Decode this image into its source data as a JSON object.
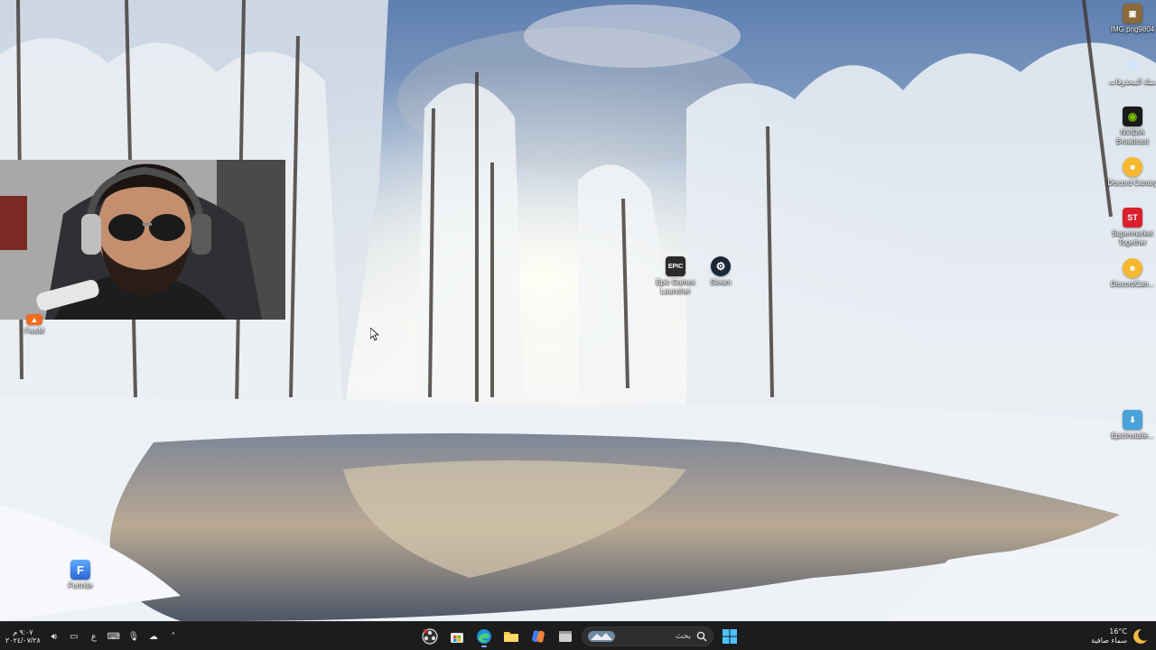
{
  "desktop": {
    "icons_right": [
      {
        "label": "IMG.png9804",
        "icon": "image-file-icon",
        "color": "#8a6a3a"
      },
      {
        "label": "سلة المحذوفات",
        "icon": "recycle-bin-icon",
        "color": "#7fb3e6"
      },
      {
        "label": "NVIDIA Broadcast",
        "icon": "nvidia-icon",
        "color": "#76b900"
      },
      {
        "label": "Discord Canary",
        "icon": "discord-canary-icon",
        "color": "#f5b82e"
      },
      {
        "label": "Supermarket Together",
        "icon": "supermarket-icon",
        "color": "#d9202c"
      },
      {
        "label": "DiscordCan...",
        "icon": "discord-icon",
        "color": "#f5b82e"
      },
      {
        "label": "EpicInstalle...",
        "icon": "installer-icon",
        "color": "#4aa3d8"
      }
    ],
    "epic": {
      "label": "Epic Games Launcher",
      "glyph": "EPIC"
    },
    "steam": {
      "label": "Steam"
    },
    "fivem": {
      "label": "FiveM"
    },
    "fortnite": {
      "label": "Fortnite",
      "glyph": "F"
    }
  },
  "taskbar": {
    "clock_time": "٩:٠٧ م",
    "clock_date": "٢٠٢٤/٠٧/٢٨",
    "input_lang": "ع",
    "search_placeholder": "بحث",
    "weather_temp": "16°C",
    "weather_desc": "سماء صافية",
    "apps": [
      "obs-icon",
      "microsoft-store-icon",
      "edge-icon",
      "file-explorer-icon",
      "copilot-icon",
      "window-icon"
    ]
  }
}
